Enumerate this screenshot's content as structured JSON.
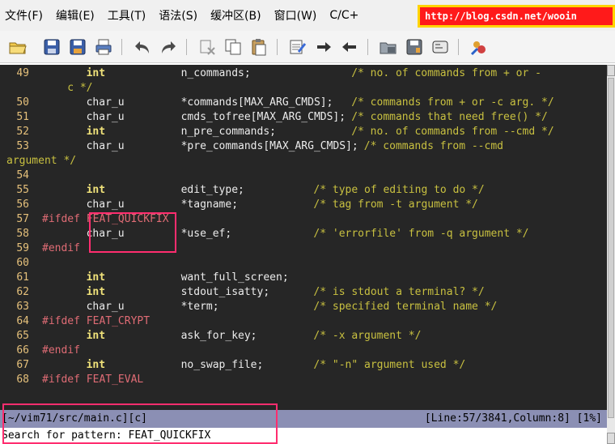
{
  "menubar": {
    "items": [
      "文件(F)",
      "编辑(E)",
      "工具(T)",
      "语法(S)",
      "缓冲区(B)",
      "窗口(W)",
      "C/C+"
    ],
    "url": "http://blog.csdn.net/wooin"
  },
  "toolbar": {
    "icons": [
      "open-folder-icon",
      "save-icon",
      "save-all-icon",
      "print-icon",
      "undo-icon",
      "redo-icon",
      "cut-icon",
      "copy-icon",
      "paste-icon",
      "find-replace-icon",
      "find-next-icon",
      "find-prev-icon",
      "load-session-icon",
      "save-session-icon",
      "run-script-icon",
      "tags-icon"
    ]
  },
  "editor": {
    "lines": [
      {
        "n": "49",
        "segs": [
          {
            "t": "int",
            "c": "kw",
            "col": 7
          },
          {
            "t": "n_commands;",
            "c": "id",
            "col": 22
          },
          {
            "t": "/* no. of commands from + or -",
            "c": "cm",
            "col": 49
          }
        ]
      },
      {
        "n": "",
        "segs": [
          {
            "t": "c */",
            "c": "cm",
            "col": 4
          }
        ]
      },
      {
        "n": "50",
        "segs": [
          {
            "t": "char_u",
            "c": "id",
            "col": 7
          },
          {
            "t": "*commands[MAX_ARG_CMDS];",
            "c": "id",
            "col": 22
          },
          {
            "t": "/* commands from + or -c arg. */",
            "c": "cm",
            "col": 49
          }
        ]
      },
      {
        "n": "51",
        "segs": [
          {
            "t": "char_u",
            "c": "id",
            "col": 7
          },
          {
            "t": "cmds_tofree[MAX_ARG_CMDS];",
            "c": "id",
            "col": 22
          },
          {
            "t": "/* commands that need free() */",
            "c": "cm",
            "col": 49
          }
        ]
      },
      {
        "n": "52",
        "segs": [
          {
            "t": "int",
            "c": "kw",
            "col": 7
          },
          {
            "t": "n_pre_commands;",
            "c": "id",
            "col": 22
          },
          {
            "t": "/* no. of commands from --cmd */",
            "c": "cm",
            "col": 49
          }
        ]
      },
      {
        "n": "53",
        "segs": [
          {
            "t": "char_u",
            "c": "id",
            "col": 7
          },
          {
            "t": "*pre_commands[MAX_ARG_CMDS];",
            "c": "id",
            "col": 22
          },
          {
            "t": "/* commands from --cmd",
            "c": "cm",
            "col": 51
          }
        ]
      },
      {
        "n": "",
        "segs": [
          {
            "t": "argument */",
            "c": "cm",
            "col": 0
          }
        ]
      },
      {
        "n": "54",
        "segs": []
      },
      {
        "n": "55",
        "segs": [
          {
            "t": "int",
            "c": "kw",
            "col": 7
          },
          {
            "t": "edit_type;",
            "c": "id",
            "col": 22
          },
          {
            "t": "/* type of editing to do */",
            "c": "cm",
            "col": 43
          }
        ]
      },
      {
        "n": "56",
        "segs": [
          {
            "t": "char_u",
            "c": "id",
            "col": 7
          },
          {
            "t": "*tagname;",
            "c": "id",
            "col": 22
          },
          {
            "t": "/* tag from -t argument */",
            "c": "cm",
            "col": 43
          }
        ]
      },
      {
        "n": "57",
        "segs": [
          {
            "t": "#ifdef FEAT_QUICKFIX",
            "c": "pp",
            "col": 0
          }
        ]
      },
      {
        "n": "58",
        "segs": [
          {
            "t": "char_u",
            "c": "id",
            "col": 7
          },
          {
            "t": "*use_ef;",
            "c": "id",
            "col": 22
          },
          {
            "t": "/* 'errorfile' from -q argument */",
            "c": "cm",
            "col": 43
          }
        ]
      },
      {
        "n": "59",
        "segs": [
          {
            "t": "#endif",
            "c": "pp",
            "col": 0
          }
        ]
      },
      {
        "n": "60",
        "segs": []
      },
      {
        "n": "61",
        "segs": [
          {
            "t": "int",
            "c": "kw",
            "col": 7
          },
          {
            "t": "want_full_screen;",
            "c": "id",
            "col": 22
          }
        ]
      },
      {
        "n": "62",
        "segs": [
          {
            "t": "int",
            "c": "kw",
            "col": 7
          },
          {
            "t": "stdout_isatty;",
            "c": "id",
            "col": 22
          },
          {
            "t": "/* is stdout a terminal? */",
            "c": "cm",
            "col": 43
          }
        ]
      },
      {
        "n": "63",
        "segs": [
          {
            "t": "char_u",
            "c": "id",
            "col": 7
          },
          {
            "t": "*term;",
            "c": "id",
            "col": 22
          },
          {
            "t": "/* specified terminal name */",
            "c": "cm",
            "col": 43
          }
        ]
      },
      {
        "n": "64",
        "segs": [
          {
            "t": "#ifdef FEAT_CRYPT",
            "c": "pp",
            "col": 0
          }
        ]
      },
      {
        "n": "65",
        "segs": [
          {
            "t": "int",
            "c": "kw",
            "col": 7
          },
          {
            "t": "ask_for_key;",
            "c": "id",
            "col": 22
          },
          {
            "t": "/* -x argument */",
            "c": "cm",
            "col": 43
          }
        ]
      },
      {
        "n": "66",
        "segs": [
          {
            "t": "#endif",
            "c": "pp",
            "col": 0
          }
        ]
      },
      {
        "n": "67",
        "segs": [
          {
            "t": "int",
            "c": "kw",
            "col": 7
          },
          {
            "t": "no_swap_file;",
            "c": "id",
            "col": 22
          },
          {
            "t": "/* \"-n\" argument used */",
            "c": "cm",
            "col": 43
          }
        ]
      },
      {
        "n": "68",
        "segs": [
          {
            "t": "#ifdef FEAT_EVAL",
            "c": "pp",
            "col": 0
          }
        ]
      }
    ]
  },
  "statusline": {
    "left": "[~/vim71/src/main.c][c]",
    "right": "[Line:57/3841,Column:8] [1%]"
  },
  "cmdline": {
    "text": "Search for pattern: FEAT_QUICKFIX"
  }
}
